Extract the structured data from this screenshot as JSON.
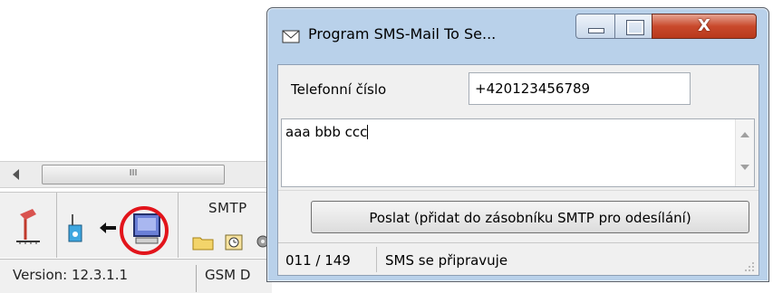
{
  "background_app": {
    "scroll_thumb_glyph": "III",
    "toolbar": {
      "smtp_label": "SMTP"
    },
    "statusbar": {
      "version": "Version: 12.3.1.1",
      "gsm": "GSM D"
    },
    "highlight_color": "#e2141b"
  },
  "dialog": {
    "title": "Program SMS-Mail To Se...",
    "title_icon": "envelope-icon",
    "controls": {
      "minimize": "minimize-icon",
      "maximize": "maximize-icon",
      "close": "X"
    },
    "phone": {
      "label": "Telefonní číslo",
      "value": "+420123456789"
    },
    "message": {
      "value": "aaa bbb ccc"
    },
    "send_button": "Poslat (přidat do zásobníku SMTP pro odesílání)",
    "status": {
      "counter": "011 / 149",
      "message": "SMS se připravuje"
    }
  }
}
